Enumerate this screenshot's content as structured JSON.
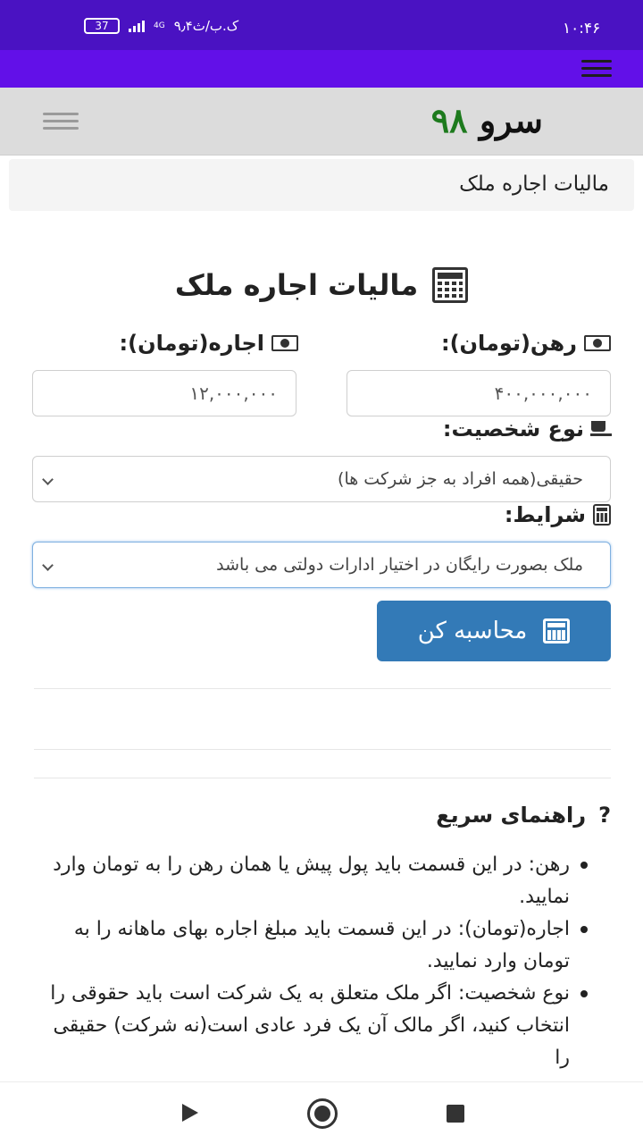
{
  "status_bar": {
    "time": "۱۰:۴۶",
    "speed": "۹٫۴ک.ب/ث",
    "network": "4G",
    "battery": "37"
  },
  "header": {
    "logo_word": "سرو",
    "logo_number": "۹۸"
  },
  "breadcrumb": "مالیات اجاره ملک",
  "page_title": "مالیات اجاره ملک",
  "form": {
    "deposit_label": "رهن(تومان):",
    "deposit_value": "۴۰۰,۰۰۰,۰۰۰",
    "rent_label": "اجاره(تومان):",
    "rent_value": "۱۲,۰۰۰,۰۰۰",
    "person_type_label": "نوع شخصیت:",
    "person_type_value": "حقیقی(همه افراد به جز شرکت ها)",
    "conditions_label": "شرایط:",
    "conditions_value": "ملک بصورت رایگان در اختیار ادارات دولتی می باشد",
    "calculate_label": "محاسبه کن"
  },
  "guide": {
    "title": "راهنمای سریع",
    "title_icon": "?",
    "items": [
      "رهن: در این قسمت باید پول پیش یا همان رهن را به تومان وارد نمایید.",
      "اجاره(تومان): در این قسمت باید مبلغ اجاره بهای ماهانه را به تومان وارد نمایید.",
      "نوع شخصیت: اگر ملک متعلق به یک شرکت است باید حقوقی را انتخاب کنید، اگر مالک آن یک فرد عادی است(نه شرکت) حقیقی را"
    ]
  },
  "colors": {
    "status_bar": "#4a12c2",
    "app_bar": "#6210e8",
    "button": "#337ab7",
    "logo_number": "#1d7a1d"
  }
}
